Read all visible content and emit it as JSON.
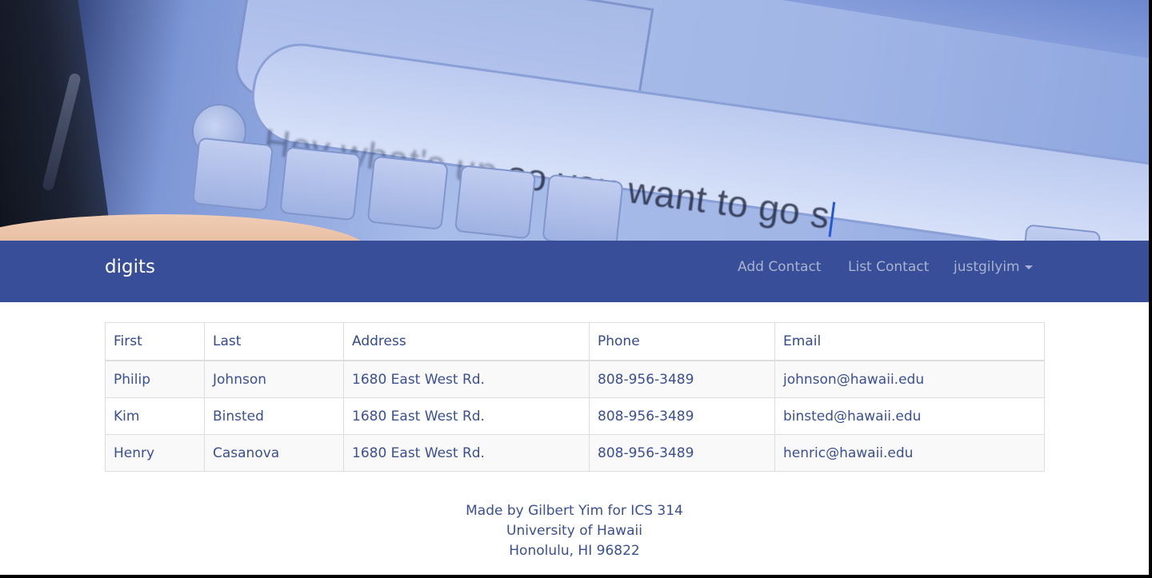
{
  "hero": {
    "image_name": "phone-message-banner",
    "typed_text_prefix": "Hey what's up",
    "typed_text_main": "so you want to go s"
  },
  "navbar": {
    "brand": "digits",
    "links": [
      {
        "label": "Add Contact"
      },
      {
        "label": "List Contact"
      }
    ],
    "user": {
      "label": "justgilyim",
      "icon": "caret-down-icon"
    },
    "background_color": "#384e98"
  },
  "table": {
    "headers": [
      "First",
      "Last",
      "Address",
      "Phone",
      "Email"
    ],
    "rows": [
      {
        "first": "Philip",
        "last": "Johnson",
        "address": "1680 East West Rd.",
        "phone": "808-956-3489",
        "email": "johnson@hawaii.edu"
      },
      {
        "first": "Kim",
        "last": "Binsted",
        "address": "1680 East West Rd.",
        "phone": "808-956-3489",
        "email": "binsted@hawaii.edu"
      },
      {
        "first": "Henry",
        "last": "Casanova",
        "address": "1680 East West Rd.",
        "phone": "808-956-3489",
        "email": "henric@hawaii.edu"
      }
    ]
  },
  "footer": {
    "lines": [
      "Made by Gilbert Yim for ICS 314",
      "University of Hawaii",
      "Honolulu, HI 96822"
    ]
  }
}
